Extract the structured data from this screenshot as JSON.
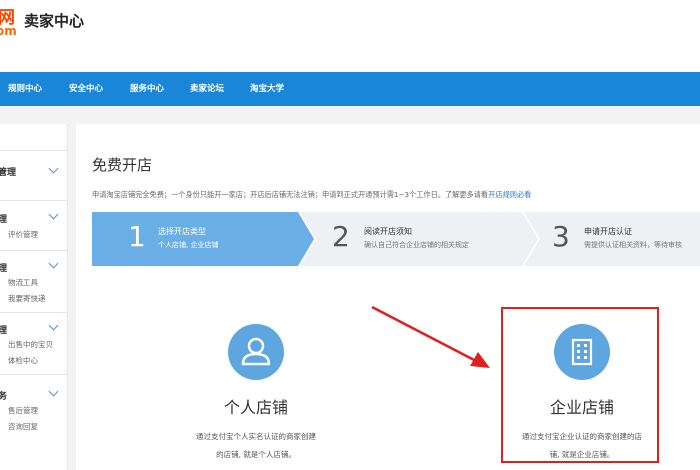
{
  "header": {
    "logo_wang": "网",
    "logo_com": "om",
    "title": "卖家中心"
  },
  "nav": {
    "items": [
      "规则中心",
      "安全中心",
      "服务中心",
      "卖家论坛",
      "淘宝大学"
    ]
  },
  "sidebar": {
    "groups": [
      {
        "title": "管理",
        "subs": []
      },
      {
        "title": "理",
        "subs": [
          "评价管理"
        ]
      },
      {
        "title": "理",
        "subs": [
          "物流工具",
          "我要寄快递"
        ]
      },
      {
        "title": "理",
        "subs": [
          "出售中的宝贝",
          "体检中心"
        ]
      },
      {
        "title": "务",
        "subs": [
          "售后管理",
          "咨询回复"
        ]
      }
    ]
  },
  "main": {
    "title": "免费开店",
    "desc": "申请淘宝店铺完全免费；一个身份只能开一家店；开店后店铺无法注销；申请到正式开通预计需1~3个工作日。了解更多请看",
    "desc_link": "开店规则必看"
  },
  "steps": [
    {
      "num": "1",
      "title": "选择开店类型",
      "sub": "个人店铺, 企业店铺"
    },
    {
      "num": "2",
      "title": "阅读开店须知",
      "sub": "确认自己符合企业店铺的相关规定"
    },
    {
      "num": "3",
      "title": "申请开店认证",
      "sub": "需提供认证相关资料，等待审核"
    }
  ],
  "cards": [
    {
      "title": "个人店铺",
      "desc_line1": "通过支付宝个人实名认证的商家创建",
      "desc_line2": "的店铺, 就是个人店铺。",
      "icon": "person-icon"
    },
    {
      "title": "企业店铺",
      "desc_line1": "通过支付宝企业认证的商家创建的店",
      "desc_line2": "铺, 就是企业店铺。",
      "icon": "building-icon"
    }
  ],
  "colors": {
    "nav_blue": "#1a86d8",
    "step_active": "#6aaee6",
    "step_inactive": "#eef0f3",
    "icon_circle": "#5ea6e0",
    "highlight_red": "#e02020",
    "logo_orange": "#ff4400",
    "link_blue": "#2c7ed6"
  }
}
